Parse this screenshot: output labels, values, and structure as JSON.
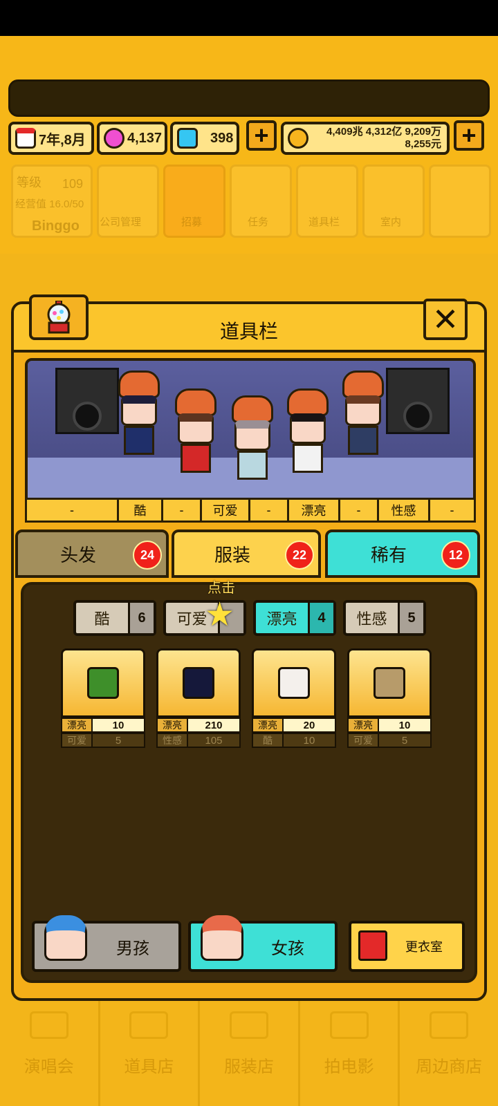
{
  "resources": {
    "date": "7年,8月",
    "gems_pink": "4,137",
    "gems_blue": "398",
    "money_line1": "4,409兆 4,312亿 9,209万",
    "money_line2": "8,255元"
  },
  "background_menu": {
    "level_label": "等级",
    "level_value": "109",
    "exp_label": "经营值 16.0/50",
    "player_name": "Binggo",
    "items": [
      "公司管理",
      "招募",
      "任务",
      "道具栏",
      "室内"
    ]
  },
  "bottom_nav": [
    "演唱会",
    "道具店",
    "服装店",
    "拍电影",
    "周边商店"
  ],
  "dialog": {
    "title": "道具栏",
    "stage_stats": [
      "-",
      "酷",
      "-",
      "可爱",
      "-",
      "漂亮",
      "-",
      "性感",
      "-"
    ],
    "tabs": [
      {
        "label": "头发",
        "count": "24"
      },
      {
        "label": "服装",
        "count": "22"
      },
      {
        "label": "稀有",
        "count": "12"
      }
    ],
    "hint": "点击",
    "filters": [
      {
        "label": "酷",
        "count": "6"
      },
      {
        "label": "可爱",
        "count": ""
      },
      {
        "label": "漂亮",
        "count": "4"
      },
      {
        "label": "性感",
        "count": "5"
      }
    ],
    "items": [
      {
        "k1": "漂亮",
        "v1": "10",
        "k2": "可爱",
        "v2": "5",
        "color": "#3e8f2a"
      },
      {
        "k1": "漂亮",
        "v1": "210",
        "k2": "性感",
        "v2": "105",
        "color": "#15183a"
      },
      {
        "k1": "漂亮",
        "v1": "20",
        "k2": "酷",
        "v2": "10",
        "color": "#f4f0ec"
      },
      {
        "k1": "漂亮",
        "v1": "10",
        "k2": "可爱",
        "v2": "5",
        "color": "#b79b6a"
      }
    ],
    "gender_buttons": {
      "boy": "男孩",
      "girl": "女孩",
      "dressing": "更衣室"
    }
  },
  "colors": {
    "accent": "#f4ae18",
    "teal": "#3ee0d6",
    "badge": "#f0221a",
    "panel": "#3b2a0c"
  }
}
